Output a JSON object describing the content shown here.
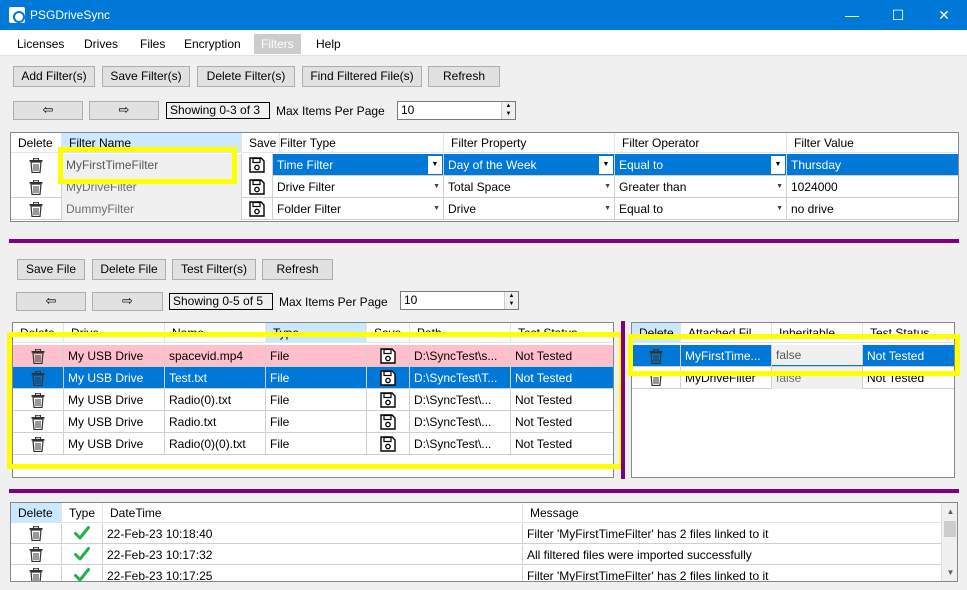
{
  "window": {
    "title": "PSGDriveSync",
    "minimize": "—",
    "maximize": "☐",
    "close": "✕"
  },
  "menu": [
    "Licenses",
    "Drives",
    "Files",
    "Encryption",
    "Filters",
    "Help"
  ],
  "filters_toolbar": {
    "add": "Add Filter(s)",
    "save": "Save Filter(s)",
    "delete": "Delete Filter(s)",
    "find": "Find Filtered File(s)",
    "refresh": "Refresh"
  },
  "filters_nav": {
    "prev": "⇦",
    "next": "⇨",
    "showing": "Showing 0-3 of 3",
    "max_label": "Max Items Per Page",
    "max_value": "10"
  },
  "filters_grid": {
    "headers": [
      "Delete",
      "Filter Name",
      "Save",
      "Filter Type",
      "Filter Property",
      "Filter Operator",
      "Filter Value"
    ],
    "rows": [
      {
        "name": "MyFirstTimeFilter",
        "type": "Time Filter",
        "property": "Day of the Week",
        "operator": "Equal to",
        "value": "Thursday"
      },
      {
        "name": "MyDriveFilter",
        "type": "Drive Filter",
        "property": "Total Space",
        "operator": "Greater than",
        "value": "1024000"
      },
      {
        "name": "DummyFilter",
        "type": "Folder Filter",
        "property": "Drive",
        "operator": "Equal to",
        "value": "no drive"
      }
    ]
  },
  "files_toolbar": {
    "save": "Save File",
    "delete": "Delete File",
    "test": "Test Filter(s)",
    "refresh": "Refresh"
  },
  "files_nav": {
    "prev": "⇦",
    "next": "⇨",
    "showing": "Showing 0-5 of 5",
    "max_label": "Max Items Per Page",
    "max_value": "10"
  },
  "files_grid": {
    "headers": [
      "Delete",
      "Drive",
      "Name",
      "Type",
      "Save",
      "Path",
      "Test Status"
    ],
    "rows": [
      {
        "drive": "My USB Drive",
        "name": "spacevid.mp4",
        "type": "File",
        "path": "D:\\SyncTest\\s...",
        "status": "Not Tested"
      },
      {
        "drive": "My USB Drive",
        "name": "Test.txt",
        "type": "File",
        "path": "D:\\SyncTest\\T...",
        "status": "Not Tested"
      },
      {
        "drive": "My USB Drive",
        "name": "Radio(0).txt",
        "type": "File",
        "path": "D:\\SyncTest\\...",
        "status": "Not Tested"
      },
      {
        "drive": "My USB Drive",
        "name": "Radio.txt",
        "type": "File",
        "path": "D:\\SyncTest\\...",
        "status": "Not Tested"
      },
      {
        "drive": "My USB Drive",
        "name": "Radio(0)(0).txt",
        "type": "File",
        "path": "D:\\SyncTest\\...",
        "status": "Not Tested"
      }
    ]
  },
  "attached_grid": {
    "headers": [
      "Delete",
      "Attached Fil...",
      "Inheritable",
      "Test Status"
    ],
    "rows": [
      {
        "filter": "MyFirstTime...",
        "inheritable": "false",
        "status": "Not Tested"
      },
      {
        "filter": "MyDriveFilter",
        "inheritable": "false",
        "status": "Not Tested"
      }
    ]
  },
  "log_grid": {
    "headers": [
      "Delete",
      "Type",
      "DateTime",
      "Message"
    ],
    "rows": [
      {
        "datetime": "22-Feb-23 10:18:40",
        "message": "Filter 'MyFirstTimeFilter' has 2 files linked to it"
      },
      {
        "datetime": "22-Feb-23 10:17:32",
        "message": "All filtered files were imported successfully"
      },
      {
        "datetime": "22-Feb-23 10:17:25",
        "message": "Filter 'MyFirstTimeFilter' has 2 files linked to it"
      }
    ]
  },
  "colors": {
    "accent": "#0078d7",
    "highlight": "#ffff00",
    "divider": "#800080",
    "error_row": "#ffc0cb",
    "ok": "#22b14c"
  },
  "icons": {
    "delete": "trash-icon",
    "save": "floppy-disk-icon",
    "log_type": "check-icon"
  }
}
